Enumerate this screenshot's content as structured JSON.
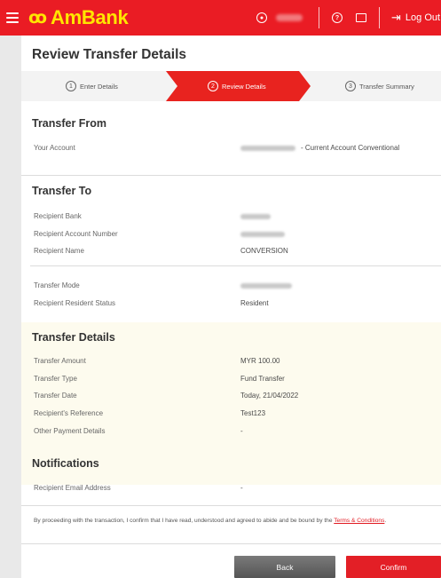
{
  "topbar": {
    "logo_text": "AmBank",
    "logo_mark": "ꝏ",
    "icons": [
      "menu-icon",
      "user-icon",
      "help-icon",
      "chat-icon",
      "logout-icon"
    ],
    "logout_label": "Log Out",
    "brand_color": "#ea1c24",
    "logo_color": "#ffe600"
  },
  "page": {
    "title": "Review Transfer Details"
  },
  "stepper": {
    "steps": [
      {
        "num": "1",
        "label": "Enter Details"
      },
      {
        "num": "2",
        "label": "Review Details"
      },
      {
        "num": "3",
        "label": "Transfer Summary"
      }
    ],
    "active_index": 1,
    "active_color": "#e8231f"
  },
  "transfer_from": {
    "heading": "Transfer From",
    "account_label": "Your Account",
    "account_value": "- Current Account Conventional"
  },
  "transfer_to": {
    "heading": "Transfer To",
    "bank_label": "Recipient Bank",
    "account_number_label": "Recipient Account Number",
    "name_label": "Recipient Name",
    "name_value": "CONVERSION",
    "mode_label": "Transfer Mode",
    "resident_label": "Recipient Resident Status",
    "resident_value": "Resident"
  },
  "transfer_details": {
    "heading": "Transfer Details",
    "amount_label": "Transfer Amount",
    "amount_value": "MYR 100.00",
    "type_label": "Transfer Type",
    "type_value": "Fund Transfer",
    "date_label": "Transfer Date",
    "date_value": "Today, 21/04/2022",
    "reference_label": "Recipient's Reference",
    "reference_value": "Test123",
    "other_label": "Other Payment Details",
    "other_value": "-"
  },
  "notifications": {
    "heading": "Notifications",
    "email_label": "Recipient Email Address",
    "email_value": "-"
  },
  "disclaimer": {
    "text": "By proceeding with the transaction, I confirm that I have read, understood and agreed to abide and be bound by the ",
    "link": "Terms & Conditions",
    "end": "."
  },
  "buttons": {
    "back": "Back",
    "confirm": "Confirm"
  }
}
